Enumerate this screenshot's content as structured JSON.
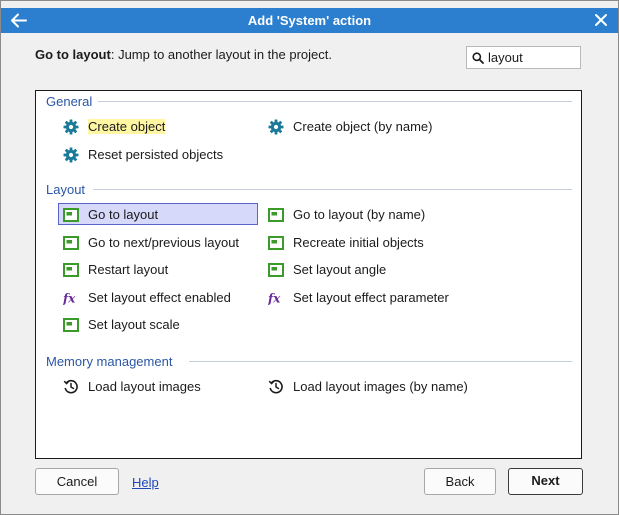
{
  "window": {
    "title": "Add 'System' action"
  },
  "header": {
    "action_name": "Go to layout",
    "action_desc": ": Jump to another layout in the project."
  },
  "search": {
    "value": "layout",
    "placeholder": ""
  },
  "groups": [
    {
      "title": "General",
      "items": [
        {
          "label": "Create object",
          "icon": "gear-icon",
          "highlighted": true
        },
        {
          "label": "Create object (by name)",
          "icon": "gear-icon"
        },
        {
          "label": "Reset persisted objects",
          "icon": "gear-icon"
        }
      ]
    },
    {
      "title": "Layout",
      "items": [
        {
          "label": "Go to layout",
          "icon": "layout-icon",
          "selected": true
        },
        {
          "label": "Go to layout (by name)",
          "icon": "layout-icon"
        },
        {
          "label": "Go to next/previous layout",
          "icon": "layout-icon"
        },
        {
          "label": "Recreate initial objects",
          "icon": "layout-icon"
        },
        {
          "label": "Restart layout",
          "icon": "layout-icon"
        },
        {
          "label": "Set layout angle",
          "icon": "layout-icon"
        },
        {
          "label": "Set layout effect enabled",
          "icon": "fx-icon"
        },
        {
          "label": "Set layout effect parameter",
          "icon": "fx-icon"
        },
        {
          "label": "Set layout scale",
          "icon": "layout-icon"
        }
      ]
    },
    {
      "title": "Memory management",
      "items": [
        {
          "label": "Load layout images",
          "icon": "reload-clock-icon"
        },
        {
          "label": "Load layout images (by name)",
          "icon": "reload-clock-icon"
        }
      ]
    }
  ],
  "footer": {
    "cancel_label": "Cancel",
    "help_label": "Help",
    "back_label": "Back",
    "next_label": "Next"
  },
  "colors": {
    "titlebar": "#2c7fce",
    "group_title": "#2a56a6",
    "gear_icon": "#1b7a9a",
    "layout_icon": "#3a9a2a",
    "fx_icon": "#6a2a9a",
    "selection": "#d6d9f9"
  }
}
